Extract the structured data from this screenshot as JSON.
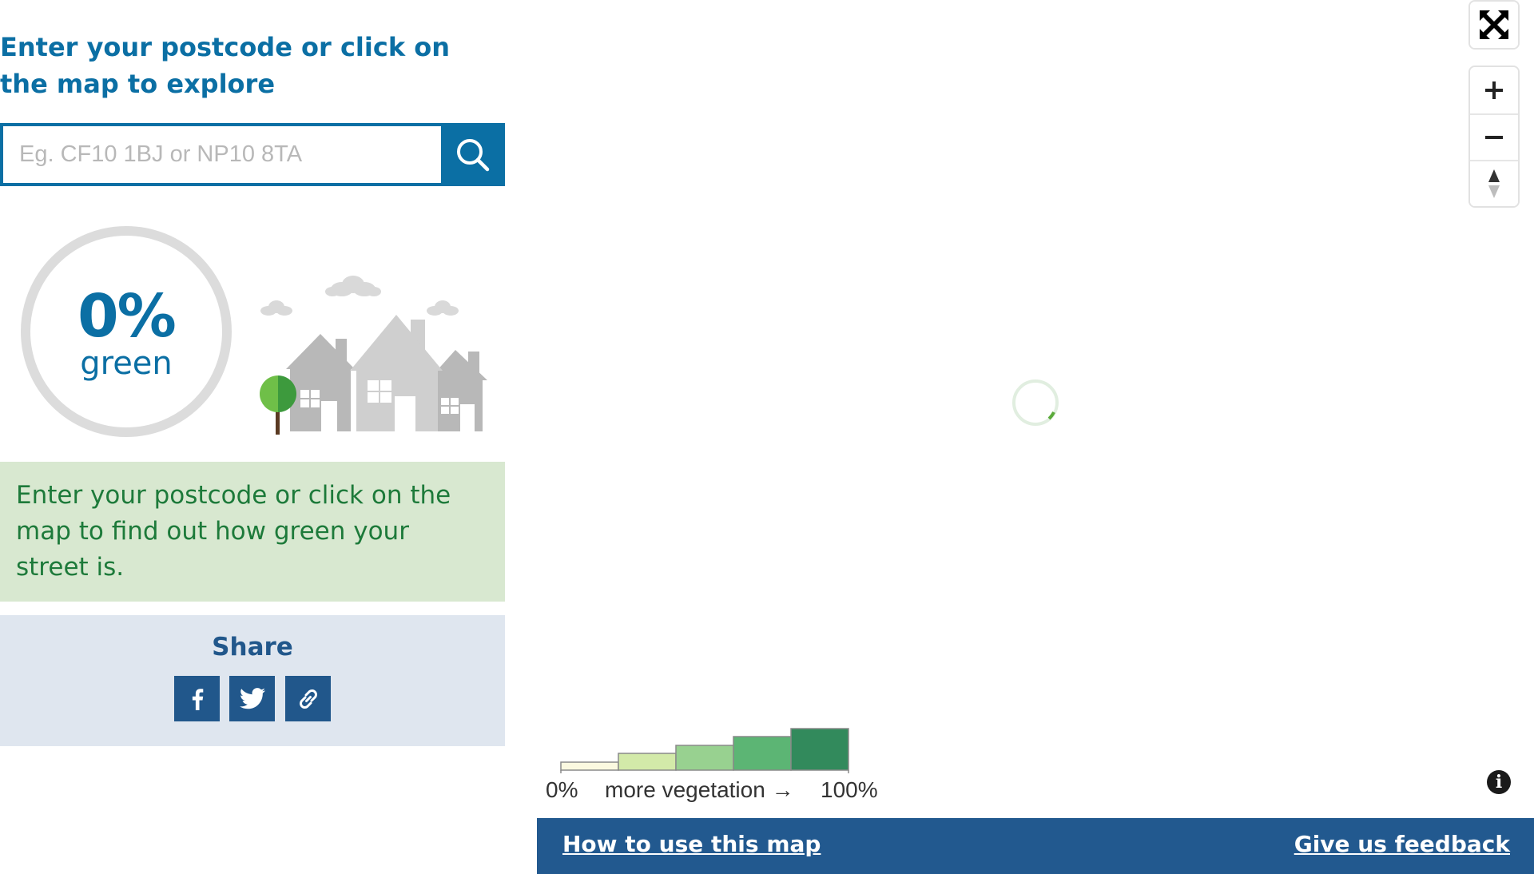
{
  "left_panel": {
    "heading": "Enter your postcode or click on the map to explore",
    "search": {
      "placeholder": "Eg. CF10 1BJ or NP10 8TA",
      "value": "",
      "button_icon": "search-icon"
    },
    "score": {
      "value": "0%",
      "label": "green"
    },
    "illustration": "houses-with-tree-and-clouds",
    "info_text": "Enter your postcode or click on the map to find out how green your street is.",
    "share": {
      "title": "Share",
      "buttons": [
        {
          "icon": "facebook-icon"
        },
        {
          "icon": "twitter-icon"
        },
        {
          "icon": "link-icon"
        }
      ]
    }
  },
  "map": {
    "controls": {
      "fullscreen_icon": "fullscreen-icon",
      "zoom_in_icon": "plus-icon",
      "zoom_out_icon": "minus-icon",
      "compass_icon": "compass-icon"
    },
    "loading": true,
    "legend": {
      "min_label": "0%",
      "middle_label": "more vegetation →",
      "max_label": "100%",
      "colors": [
        "#fbf9e0",
        "#d3eaa9",
        "#98d190",
        "#5cb574",
        "#328a5c"
      ],
      "levels": [
        1,
        2,
        3,
        4,
        5
      ]
    },
    "info_icon": "i"
  },
  "footer": {
    "how_to_label": "How to use this map",
    "feedback_label": "Give us feedback"
  },
  "colors": {
    "primary_blue": "#0b6fa4",
    "dark_blue": "#22598f",
    "green_text": "#1d7a3a",
    "info_bg": "#d8e8d0",
    "share_bg": "#dfe6ef"
  }
}
